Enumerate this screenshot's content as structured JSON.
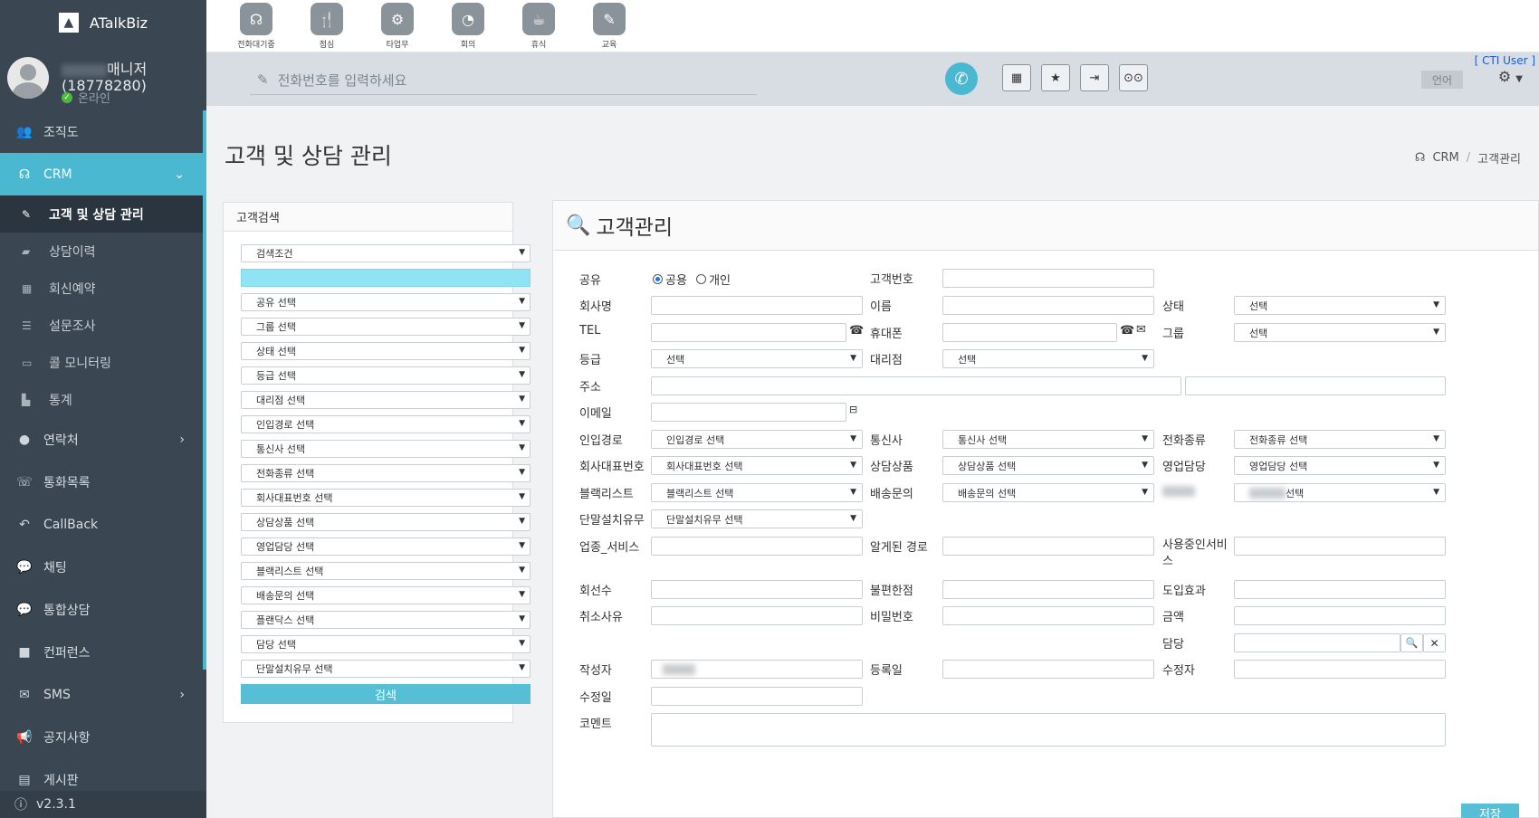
{
  "app": {
    "name": "ATalkBiz",
    "version": "v2.3.1"
  },
  "user": {
    "role": "매니저",
    "id": "(18778280)",
    "status": "온라인"
  },
  "nav": [
    {
      "label": "조직도",
      "icon": "users-icon"
    },
    {
      "label": "CRM",
      "icon": "headset-icon",
      "active": true
    },
    {
      "label": "연락처",
      "icon": "user-icon",
      "chevron": true
    },
    {
      "label": "통화목록",
      "icon": "phone-square-icon"
    },
    {
      "label": "CallBack",
      "icon": "reply-icon"
    },
    {
      "label": "채팅",
      "icon": "comments-icon"
    },
    {
      "label": "통합상담",
      "icon": "comments-icon"
    },
    {
      "label": "컨퍼런스",
      "icon": "video-icon"
    },
    {
      "label": "SMS",
      "icon": "envelope-icon",
      "chevron": true
    },
    {
      "label": "공지사항",
      "icon": "bullhorn-icon"
    },
    {
      "label": "게시판",
      "icon": "list-alt-icon"
    }
  ],
  "crm_sub": [
    {
      "label": "고객 및 상담 관리",
      "current": true
    },
    {
      "label": "상담이력"
    },
    {
      "label": "회신예약"
    },
    {
      "label": "설문조사"
    },
    {
      "label": "콜 모니터링"
    },
    {
      "label": "통계"
    }
  ],
  "toolbar": [
    {
      "label": "전화대기중",
      "icon": "headset-icon"
    },
    {
      "label": "점심",
      "icon": "utensils-icon"
    },
    {
      "label": "타업무",
      "icon": "cogs-icon"
    },
    {
      "label": "회의",
      "icon": "clock-icon"
    },
    {
      "label": "휴식",
      "icon": "coffee-icon"
    },
    {
      "label": "교육",
      "icon": "pencil-icon"
    }
  ],
  "phonebar": {
    "placeholder": "전화번호를 입력하세요",
    "cti": "[ CTI User ]",
    "lang": "언어"
  },
  "page": {
    "title": "고객 및 상담 관리",
    "breadcrumb_root": "CRM",
    "breadcrumb_current": "고객관리"
  },
  "search": {
    "header": "고객검색",
    "condition": "검색조건",
    "selects": [
      "공유 선택",
      "그룹 선택",
      "상태 선택",
      "등급 선택",
      "대리점 선택",
      "인입경로 선택",
      "통신사 선택",
      "전화종류 선택",
      "회사대표번호 선택",
      "상담상품 선택",
      "영업담당 선택",
      "블랙리스트 선택",
      "배송문의 선택",
      "플랜닥스 선택",
      "담당 선택",
      "단말설치유무 선택"
    ],
    "button": "검색"
  },
  "customer": {
    "header": "고객관리",
    "labels": {
      "share": "공유",
      "share_public": "공용",
      "share_private": "개인",
      "customer_no": "고객번호",
      "company": "회사명",
      "name": "이름",
      "status": "상태",
      "tel": "TEL",
      "mobile": "휴대폰",
      "group": "그룹",
      "grade": "등급",
      "agency": "대리점",
      "address": "주소",
      "email": "이메일",
      "inbound": "인입경로",
      "carrier": "통신사",
      "phone_type": "전화종류",
      "company_rep": "회사대표번호",
      "product": "상담상품",
      "sales": "영업담당",
      "blacklist": "블랙리스트",
      "delivery": "배송문의",
      "terminal": "단말설치유무",
      "industry": "업종_서비스",
      "known_route": "알게된 경로",
      "service_in_use": "사용중인서비스",
      "lines": "회선수",
      "inconvenience": "불편한점",
      "effect": "도입효과",
      "cancel_reason": "취소사유",
      "password": "비밀번호",
      "amount": "금액",
      "manager": "담당",
      "writer": "작성자",
      "reg_date": "등록일",
      "modifier": "수정자",
      "mod_date": "수정일",
      "comment": "코멘트"
    },
    "selects": {
      "status": "선택",
      "group": "선택",
      "grade": "선택",
      "agency": "선택",
      "inbound": "인입경로 선택",
      "carrier": "통신사 선택",
      "phone_type": "전화종류 선택",
      "company_rep": "회사대표번호 선택",
      "product": "상담상품 선택",
      "sales": "영업담당 선택",
      "blacklist": "블랙리스트 선택",
      "delivery": "배송문의 선택",
      "blurred": "선택",
      "terminal": "단말설치유무 선택"
    },
    "save": "저장"
  }
}
